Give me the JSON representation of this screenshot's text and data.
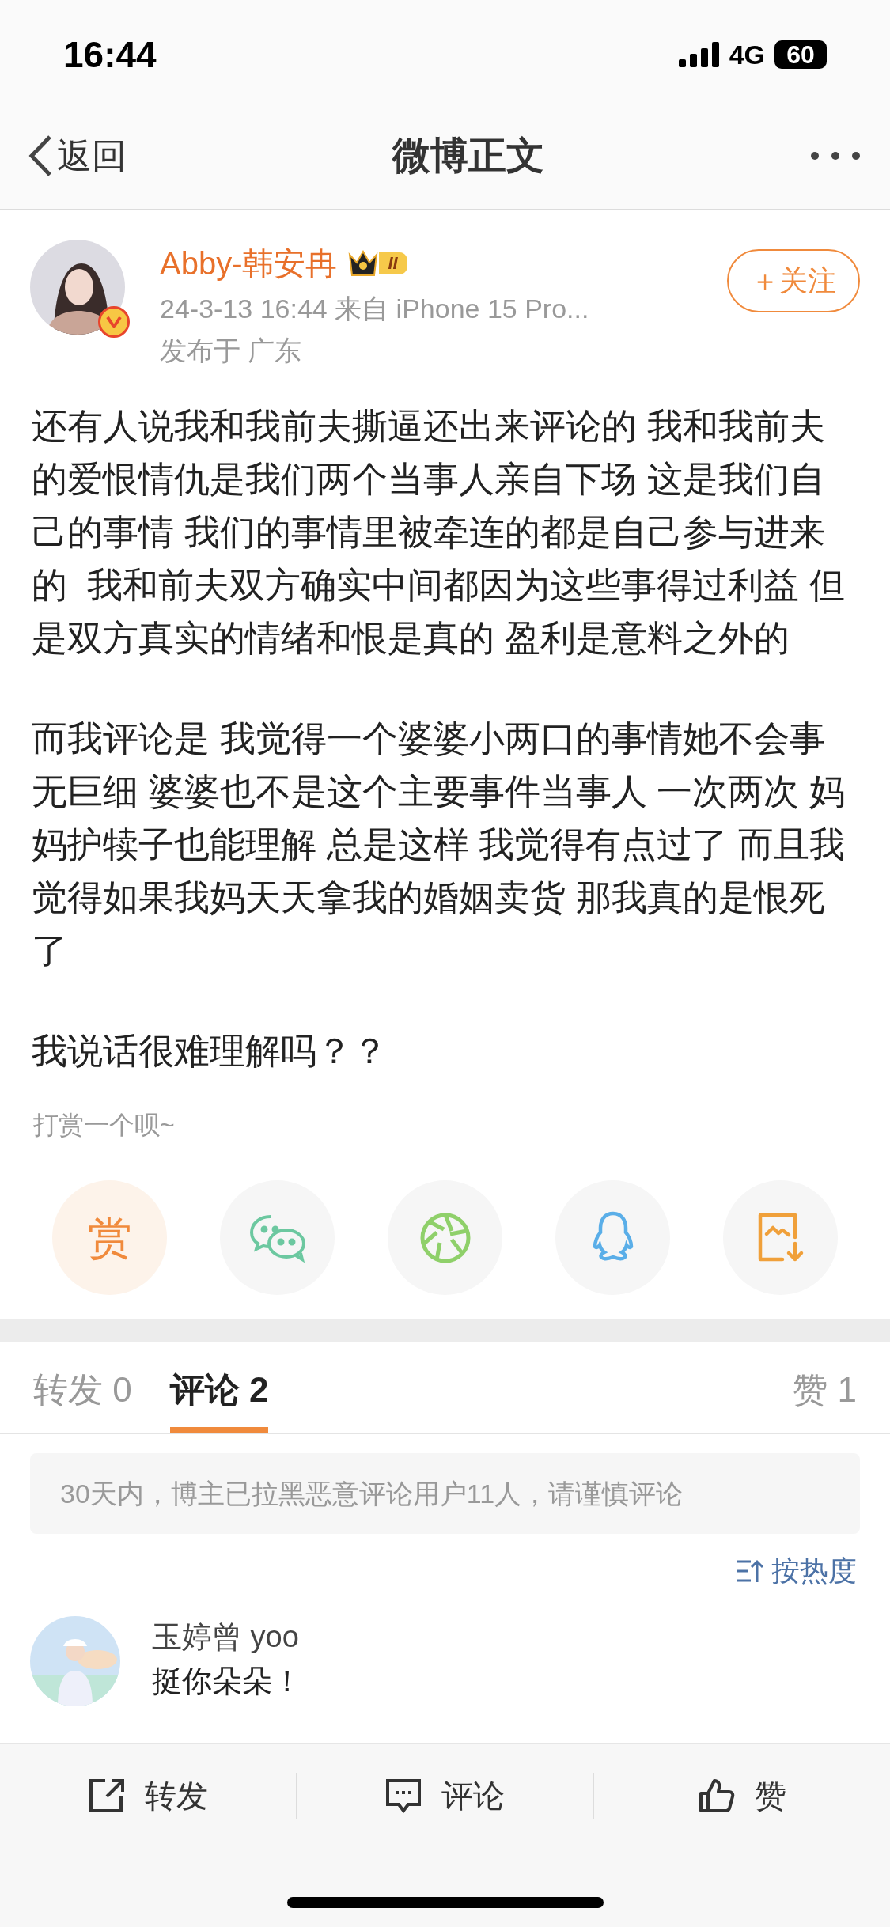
{
  "status_bar": {
    "time": "16:44",
    "network": "4G",
    "battery": "60"
  },
  "nav": {
    "back": "返回",
    "title": "微博正文"
  },
  "post": {
    "author": "Abby-韩安冉",
    "level_badge": "II",
    "meta": "24-3-13 16:44  来自 iPhone 15 Pro...",
    "location": "发布于 广东",
    "follow": "＋关注",
    "paragraphs": [
      "还有人说我和我前夫撕逼还出来评论的 我和我前夫的爱恨情仇是我们两个当事人亲自下场 这是我们自己的事情 我们的事情里被牵连的都是自己参与进来的  我和前夫双方确实中间都因为这些事得过利益 但是双方真实的情绪和恨是真的 盈利是意料之外的",
      "而我评论是 我觉得一个婆婆小两口的事情她不会事无巨细 婆婆也不是这个主要事件当事人 一次两次 妈妈护犊子也能理解 总是这样 我觉得有点过了 而且我觉得如果我妈天天拿我的婚姻卖货 那我真的是恨死了",
      "我说话很难理解吗？？"
    ]
  },
  "reward": {
    "label": "打赏一个呗~",
    "button": "赏"
  },
  "share_buttons": [
    {
      "kind": "wechat"
    },
    {
      "kind": "moments"
    },
    {
      "kind": "qq"
    },
    {
      "kind": "save-image"
    }
  ],
  "tabs": [
    {
      "label": "转发 0",
      "selected": false
    },
    {
      "label": "评论 2",
      "selected": true
    },
    {
      "label": "赞 1",
      "selected": false
    }
  ],
  "notice": "30天内，博主已拉黑恶意评论用户11人，请谨慎评论",
  "sort": "按热度",
  "comments": [
    {
      "name": "玉婷曾 yoo",
      "text": "挺你朵朵！"
    }
  ],
  "bottom_bar": [
    {
      "kind": "repost",
      "label": "转发"
    },
    {
      "kind": "comment",
      "label": "评论"
    },
    {
      "kind": "like",
      "label": "赞"
    }
  ]
}
